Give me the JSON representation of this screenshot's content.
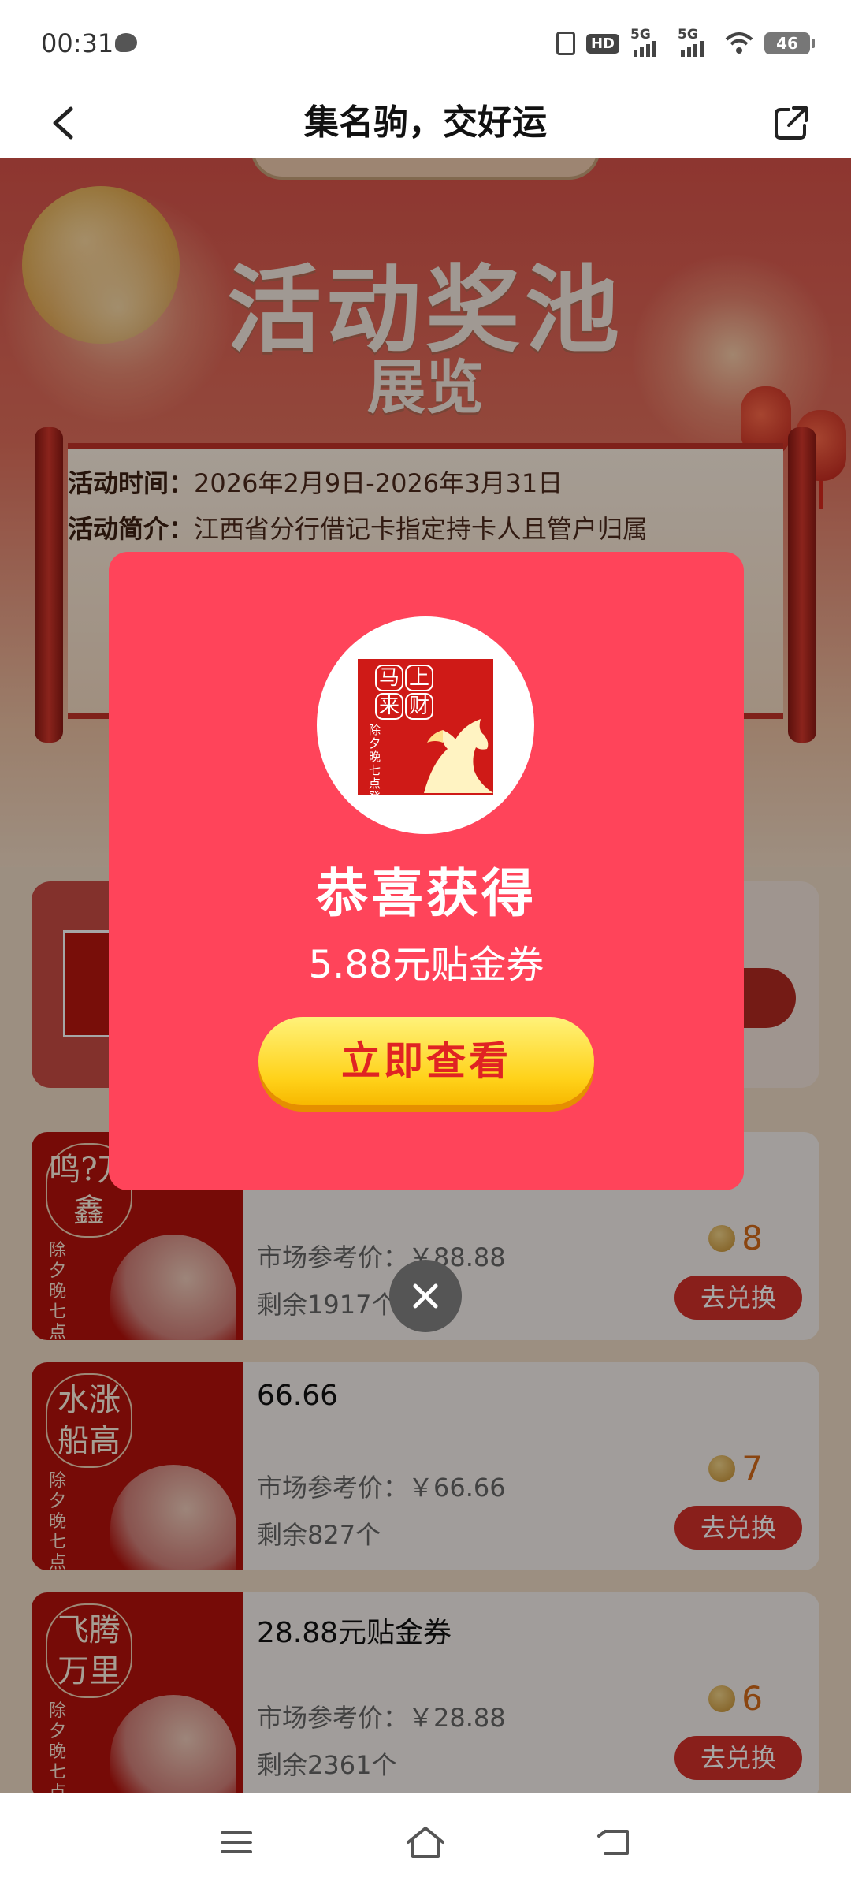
{
  "status_bar": {
    "time": "00:31",
    "hd_label": "HD",
    "sim1_label": "5G",
    "sim2_label": "5G",
    "battery": "46"
  },
  "title_bar": {
    "title": "集名驹，交好运",
    "back_icon": "chevron-left-icon",
    "share_icon": "share-external-icon"
  },
  "hero": {
    "title": "活动奖池",
    "subtitle": "展览",
    "time_label": "活动时间：",
    "time_value": "2026年2月9日-2026年3月31日",
    "intro_label": "活动简介：",
    "intro_value": "江西省分行借记卡指定持卡人且管户归属"
  },
  "prizes": [
    {
      "thumb_title": "鸣?万鑫",
      "thumb_vertical": "除夕晚七点登录",
      "name": "",
      "ref_price": "市场参考价：￥88.88",
      "stock": "剩余1917个",
      "cost": "8",
      "button": "去兑换"
    },
    {
      "thumb_title": "水涨船高",
      "thumb_vertical": "除夕晚七点登录",
      "name": "66.66",
      "ref_price": "市场参考价：￥66.66",
      "stock": "剩余827个",
      "cost": "7",
      "button": "去兑换"
    },
    {
      "thumb_title": "飞腾万里",
      "thumb_vertical": "除夕晚七点登录",
      "name": "28.88元贴金券",
      "ref_price": "市场参考价：￥28.88",
      "stock": "剩余2361个",
      "cost": "6",
      "button": "去兑换"
    }
  ],
  "dialog": {
    "seal_text": [
      "马",
      "上",
      "来",
      "财"
    ],
    "seal_vertical": "除夕晚七点登录",
    "title": "恭喜获得",
    "subtitle": "5.88元贴金券",
    "button": "立即查看",
    "close_icon": "close-icon"
  },
  "colors": {
    "dialog_bg": "#ff445a",
    "button_yellow": "#ffd21a",
    "button_text": "#e02323",
    "redeem_red": "#d3312a"
  },
  "nav_bar": {
    "menu_icon": "menu-icon",
    "home_icon": "home-icon",
    "back_icon": "back-arrow-icon"
  }
}
